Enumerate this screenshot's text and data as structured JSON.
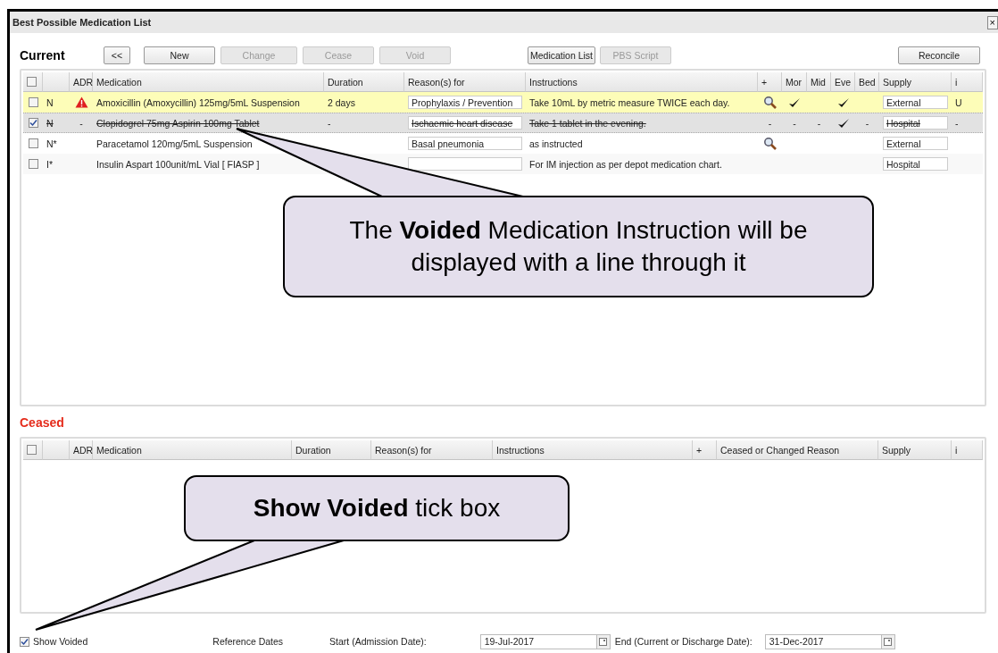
{
  "window": {
    "title": "Best Possible Medication List",
    "close": "×"
  },
  "current": {
    "heading": "Current",
    "buttons": [
      {
        "label": "<<",
        "disabled": false
      },
      {
        "label": "New",
        "disabled": false
      },
      {
        "label": "Change",
        "disabled": true
      },
      {
        "label": "Cease",
        "disabled": true
      },
      {
        "label": "Void",
        "disabled": true
      },
      {
        "label": "Medication List",
        "disabled": false
      },
      {
        "label": "PBS Script",
        "disabled": true
      },
      {
        "label": "Reconcile",
        "disabled": false
      }
    ],
    "select_all_checked": false,
    "columns": [
      "ADR",
      "Medication",
      "Duration",
      "Reason(s) for",
      "Instructions",
      "+",
      "Mor",
      "Mid",
      "Eve",
      "Bed",
      "Supply",
      "i"
    ],
    "rows": [
      {
        "checked": false,
        "highlighted": true,
        "voided": false,
        "type": "N",
        "adr": {
          "kind": "warning"
        },
        "medication": "Amoxicillin (Amoxycillin) 125mg/5mL Suspension",
        "duration": "2 days",
        "reason": "Prophylaxis / Prevention",
        "instructions": "Take 10mL by metric measure TWICE each day.",
        "plus": {
          "kind": "magnifier"
        },
        "doses": [
          {
            "kind": "tick"
          },
          {
            "kind": "blank"
          },
          {
            "kind": "tick"
          },
          {
            "kind": "blank"
          }
        ],
        "supply": "External",
        "info": "U"
      },
      {
        "checked": true,
        "highlighted": false,
        "voided": true,
        "type": "N",
        "adr": {
          "kind": "text",
          "text": "-"
        },
        "medication": "Clopidogrel 75mg Aspirin 100mg Tablet",
        "duration": "-",
        "reason": "Ischaemic heart disease",
        "instructions": "Take 1 tablet in the evening.",
        "plus": {
          "kind": "text",
          "text": "-"
        },
        "doses": [
          {
            "kind": "text",
            "text": "-"
          },
          {
            "kind": "text",
            "text": "-"
          },
          {
            "kind": "tick"
          },
          {
            "kind": "text",
            "text": "-"
          }
        ],
        "supply": "Hospital",
        "info": "-"
      },
      {
        "checked": false,
        "highlighted": false,
        "voided": false,
        "type": "N*",
        "adr": {
          "kind": "blank"
        },
        "medication": "Paracetamol 120mg/5mL Suspension",
        "reason": "Basal pneumonia",
        "instructions": "as instructed",
        "plus": {
          "kind": "magnifier"
        },
        "doses": [
          {
            "kind": "blank"
          },
          {
            "kind": "blank"
          },
          {
            "kind": "blank"
          },
          {
            "kind": "blank"
          }
        ],
        "supply": "External"
      },
      {
        "checked": false,
        "highlighted": false,
        "voided": false,
        "type": "I*",
        "adr": {
          "kind": "blank"
        },
        "medication": "Insulin Aspart 100unit/mL Vial [ FIASP ]",
        "instructions": "For IM injection as per depot medication chart.",
        "plus": {
          "kind": "blank"
        },
        "doses": [
          {
            "kind": "blank"
          },
          {
            "kind": "blank"
          },
          {
            "kind": "blank"
          },
          {
            "kind": "blank"
          }
        ],
        "supply": "Hospital"
      }
    ]
  },
  "ceased": {
    "heading": "Ceased",
    "select_all_checked": false,
    "columns": [
      "ADR",
      "Medication",
      "Duration",
      "Reason(s) for",
      "Instructions",
      "+",
      "Ceased or Changed Reason",
      "Supply",
      "i"
    ]
  },
  "footer": {
    "show_voided": {
      "label": "Show Voided",
      "checked": true
    },
    "reference_label": "Reference Dates",
    "start_label": "Start (Admission Date):",
    "start_value": "19-Jul-2017",
    "end_label": "End (Current or Discharge Date):",
    "end_value": "31-Dec-2017"
  },
  "callouts": [
    {
      "text": "The **Voided** Medication Instruction will be displayed with a line through it"
    },
    {
      "text": "**Show Voided** tick box"
    }
  ]
}
